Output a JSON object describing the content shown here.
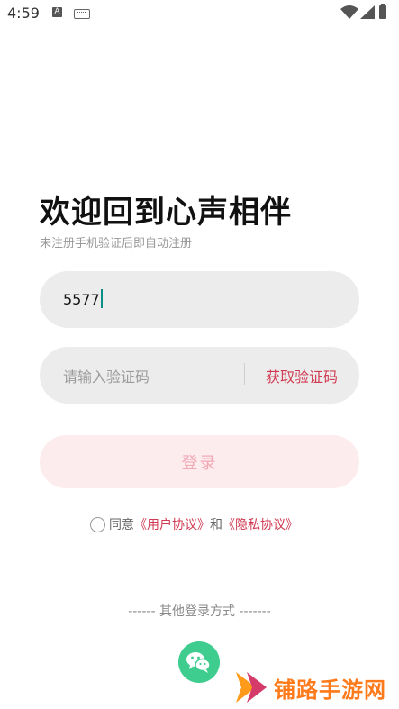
{
  "status_bar": {
    "time": "4:59",
    "input_indicator": "A"
  },
  "header": {
    "title": "欢迎回到心声相伴",
    "subtitle": "未注册手机验证后即自动注册"
  },
  "phone_input": {
    "value": "5577"
  },
  "code_input": {
    "placeholder": "请输入验证码",
    "get_code_label": "获取验证码"
  },
  "login_button": {
    "label": "登录"
  },
  "agreement": {
    "prefix": "同意",
    "user_agreement": "《用户协议》",
    "conjunction": "和",
    "privacy_agreement": "《隐私协议》"
  },
  "other_login": {
    "label": "------ 其他登录方式 -------"
  },
  "watermark": {
    "text": "铺路手游网"
  },
  "colors": {
    "accent": "#d03a52",
    "field_bg": "#ececec",
    "login_bg": "#fdeced",
    "wechat": "#3fcc8f",
    "watermark": "#ff7a1a"
  },
  "icons": {
    "wifi": "wifi-icon",
    "signal": "signal-icon",
    "battery": "battery-icon",
    "keyboard": "keyboard-icon",
    "wechat": "wechat-icon"
  }
}
